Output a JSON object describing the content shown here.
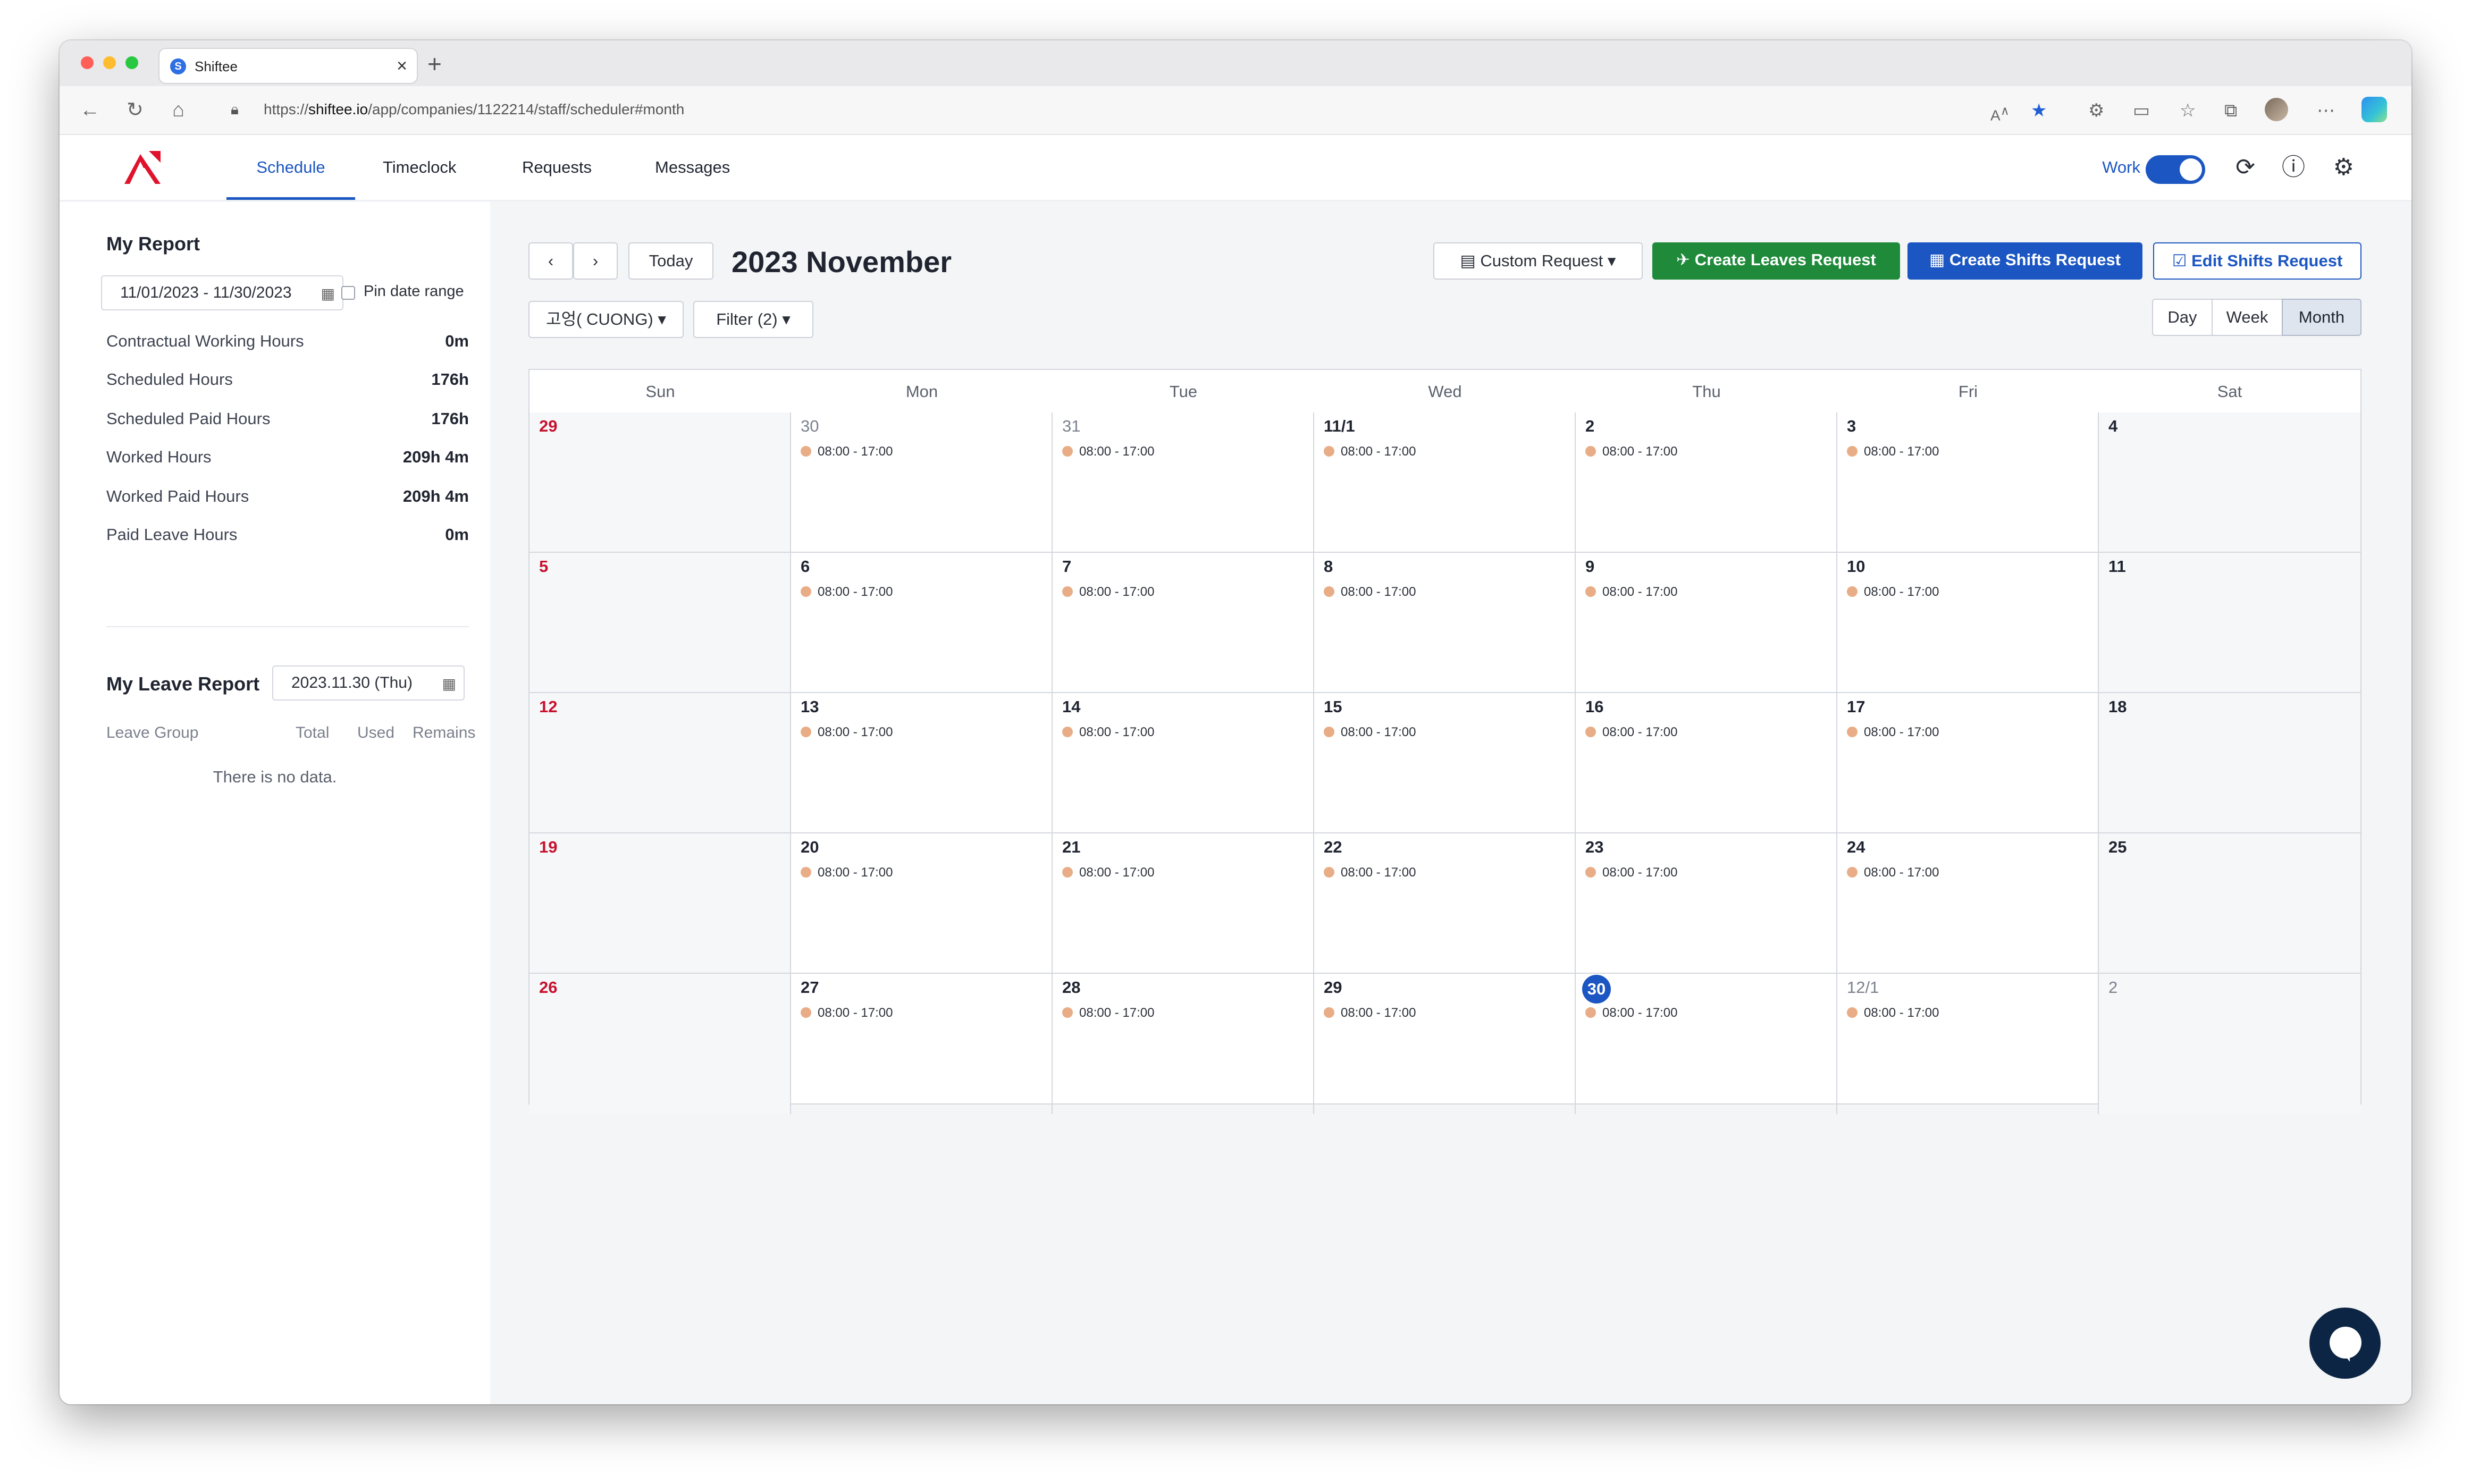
{
  "browser": {
    "tab_title": "Shiftee",
    "tab_close": "×",
    "new_tab": "+",
    "url_prefix": "https://",
    "url_domain": "shiftee.io",
    "url_path": "/app/companies/1122214/staff/scheduler#month",
    "icons": [
      "back-icon",
      "reload-icon",
      "home-icon",
      "lock-icon",
      "read-aloud-icon",
      "favorite-star-icon",
      "extensions-icon",
      "cast-icon",
      "favorites-icon",
      "collections-icon",
      "profile-avatar",
      "more-icon",
      "copilot-icon"
    ]
  },
  "app": {
    "nav": [
      "Schedule",
      "Timeclock",
      "Requests",
      "Messages"
    ],
    "active_nav": "Schedule",
    "work_label": "Work",
    "work_toggle_on": true,
    "accent": "#1b56c2",
    "header_icons": [
      "sync-icon",
      "help-icon",
      "settings-icon"
    ]
  },
  "sidebar": {
    "report_title": "My Report",
    "date_range": "11/01/2023 - 11/30/2023",
    "pin_label": "Pin date range",
    "stats": [
      {
        "label": "Contractual Working Hours",
        "value": "0m"
      },
      {
        "label": "Scheduled Hours",
        "value": "176h"
      },
      {
        "label": "Scheduled Paid Hours",
        "value": "176h"
      },
      {
        "label": "Worked Hours",
        "value": "209h 4m"
      },
      {
        "label": "Worked Paid Hours",
        "value": "209h 4m"
      },
      {
        "label": "Paid Leave Hours",
        "value": "0m"
      }
    ],
    "leave_title": "My Leave Report",
    "leave_date": "2023.11.30 (Thu)",
    "leave_headers": {
      "group": "Leave Group",
      "total": "Total",
      "used": "Used",
      "remains": "Remains"
    },
    "no_data": "There is no data."
  },
  "toolbar": {
    "prev": "‹",
    "next": "›",
    "today": "Today",
    "month_title": "2023 November",
    "custom_request": "Custom Request",
    "create_leaves": "Create Leaves Request",
    "create_shifts": "Create Shifts Request",
    "edit_shifts": "Edit Shifts Request",
    "employee_select": "고엉( CUONG)",
    "filter": "Filter (2)",
    "views": [
      "Day",
      "Week",
      "Month"
    ],
    "active_view": "Month",
    "colors": {
      "green": "#1e8a3a",
      "blue": "#1b56c2"
    }
  },
  "calendar": {
    "weekdays": [
      "Sun",
      "Mon",
      "Tue",
      "Wed",
      "Thu",
      "Fri",
      "Sat"
    ],
    "shift_color": "#e8ad86",
    "weeks": [
      [
        {
          "d": "29",
          "s": "",
          "k": "sun"
        },
        {
          "d": "30",
          "s": "08:00 - 17:00",
          "k": "other"
        },
        {
          "d": "31",
          "s": "08:00 - 17:00",
          "k": "other"
        },
        {
          "d": "11/1",
          "s": "08:00 - 17:00",
          "k": ""
        },
        {
          "d": "2",
          "s": "08:00 - 17:00",
          "k": ""
        },
        {
          "d": "3",
          "s": "08:00 - 17:00",
          "k": ""
        },
        {
          "d": "4",
          "s": "",
          "k": ""
        }
      ],
      [
        {
          "d": "5",
          "s": "",
          "k": "sun"
        },
        {
          "d": "6",
          "s": "08:00 - 17:00",
          "k": ""
        },
        {
          "d": "7",
          "s": "08:00 - 17:00",
          "k": ""
        },
        {
          "d": "8",
          "s": "08:00 - 17:00",
          "k": ""
        },
        {
          "d": "9",
          "s": "08:00 - 17:00",
          "k": ""
        },
        {
          "d": "10",
          "s": "08:00 - 17:00",
          "k": ""
        },
        {
          "d": "11",
          "s": "",
          "k": ""
        }
      ],
      [
        {
          "d": "12",
          "s": "",
          "k": "sun"
        },
        {
          "d": "13",
          "s": "08:00 - 17:00",
          "k": ""
        },
        {
          "d": "14",
          "s": "08:00 - 17:00",
          "k": ""
        },
        {
          "d": "15",
          "s": "08:00 - 17:00",
          "k": ""
        },
        {
          "d": "16",
          "s": "08:00 - 17:00",
          "k": ""
        },
        {
          "d": "17",
          "s": "08:00 - 17:00",
          "k": ""
        },
        {
          "d": "18",
          "s": "",
          "k": ""
        }
      ],
      [
        {
          "d": "19",
          "s": "",
          "k": "sun"
        },
        {
          "d": "20",
          "s": "08:00 - 17:00",
          "k": ""
        },
        {
          "d": "21",
          "s": "08:00 - 17:00",
          "k": ""
        },
        {
          "d": "22",
          "s": "08:00 - 17:00",
          "k": ""
        },
        {
          "d": "23",
          "s": "08:00 - 17:00",
          "k": ""
        },
        {
          "d": "24",
          "s": "08:00 - 17:00",
          "k": ""
        },
        {
          "d": "25",
          "s": "",
          "k": ""
        }
      ],
      [
        {
          "d": "26",
          "s": "",
          "k": "sun"
        },
        {
          "d": "27",
          "s": "08:00 - 17:00",
          "k": ""
        },
        {
          "d": "28",
          "s": "08:00 - 17:00",
          "k": ""
        },
        {
          "d": "29",
          "s": "08:00 - 17:00",
          "k": ""
        },
        {
          "d": "30",
          "s": "08:00 - 17:00",
          "k": "today"
        },
        {
          "d": "12/1",
          "s": "08:00 - 17:00",
          "k": "other"
        },
        {
          "d": "2",
          "s": "",
          "k": "other"
        }
      ]
    ]
  }
}
